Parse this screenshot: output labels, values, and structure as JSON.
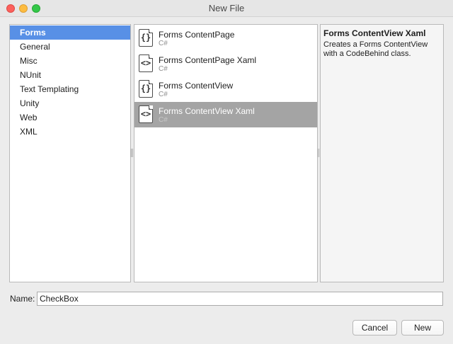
{
  "window": {
    "title": "New File"
  },
  "categories": {
    "selected_index": 0,
    "items": [
      {
        "label": "Forms"
      },
      {
        "label": "General"
      },
      {
        "label": "Misc"
      },
      {
        "label": "NUnit"
      },
      {
        "label": "Text Templating"
      },
      {
        "label": "Unity"
      },
      {
        "label": "Web"
      },
      {
        "label": "XML"
      }
    ]
  },
  "templates": {
    "selected_index": 3,
    "items": [
      {
        "name": "Forms ContentPage",
        "language": "C#",
        "icon": "code-braces-file-icon",
        "glyph": "{}"
      },
      {
        "name": "Forms ContentPage Xaml",
        "language": "C#",
        "icon": "markup-file-icon",
        "glyph": "<>"
      },
      {
        "name": "Forms ContentView",
        "language": "C#",
        "icon": "code-braces-file-icon",
        "glyph": "{}"
      },
      {
        "name": "Forms ContentView Xaml",
        "language": "C#",
        "icon": "markup-file-icon",
        "glyph": "<>"
      }
    ]
  },
  "description": {
    "title": "Forms ContentView Xaml",
    "text": "Creates a Forms ContentView with a CodeBehind class."
  },
  "name_field": {
    "label": "Name:",
    "value": "CheckBox"
  },
  "buttons": {
    "cancel_label": "Cancel",
    "new_label": "New"
  },
  "colors": {
    "selection_blue": "#5890e6",
    "selection_gray": "#a4a4a4",
    "close": "#fc605c",
    "minimize": "#fdbc40",
    "zoom": "#34c749"
  }
}
